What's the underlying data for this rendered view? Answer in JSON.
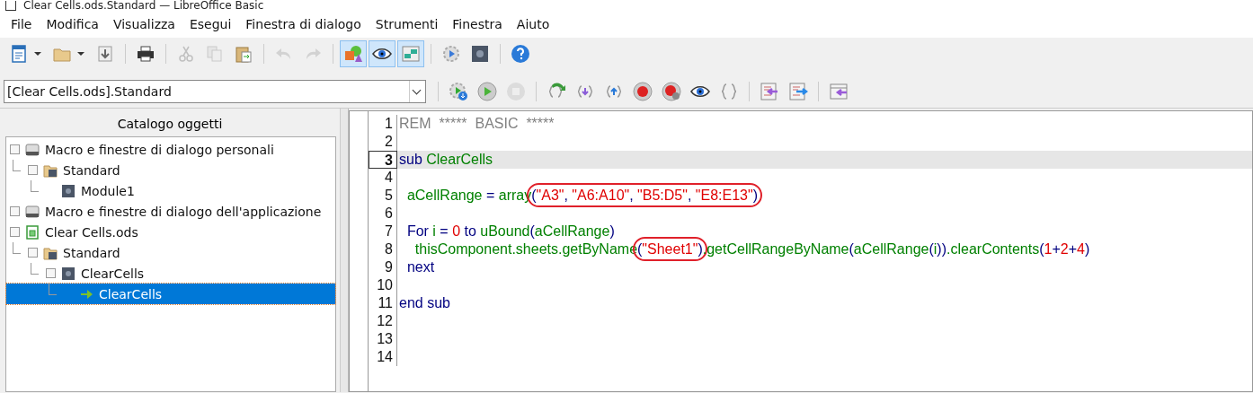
{
  "window": {
    "title": "Clear Cells.ods.Standard — LibreOffice Basic"
  },
  "menu": [
    "File",
    "Modifica",
    "Visualizza",
    "Esegui",
    "Finestra di dialogo",
    "Strumenti",
    "Finestra",
    "Aiuto"
  ],
  "toolbar": [
    {
      "kind": "new-doc",
      "dropdown": true,
      "selected": false,
      "disabled": false
    },
    {
      "kind": "folder",
      "dropdown": true,
      "selected": false,
      "disabled": false
    },
    {
      "kind": "download",
      "dropdown": false,
      "selected": false,
      "disabled": false
    },
    {
      "kind": "sep"
    },
    {
      "kind": "printer",
      "dropdown": false,
      "selected": false,
      "disabled": false
    },
    {
      "kind": "sep"
    },
    {
      "kind": "scissors",
      "dropdown": false,
      "selected": false,
      "disabled": true
    },
    {
      "kind": "copy",
      "dropdown": false,
      "selected": false,
      "disabled": true
    },
    {
      "kind": "paste",
      "dropdown": false,
      "selected": false,
      "disabled": false
    },
    {
      "kind": "sep"
    },
    {
      "kind": "undo",
      "dropdown": false,
      "selected": false,
      "disabled": true
    },
    {
      "kind": "redo",
      "dropdown": false,
      "selected": false,
      "disabled": true
    },
    {
      "kind": "sep"
    },
    {
      "kind": "shapes",
      "dropdown": false,
      "selected": true,
      "disabled": false
    },
    {
      "kind": "eye",
      "dropdown": false,
      "selected": true,
      "disabled": false
    },
    {
      "kind": "blocks",
      "dropdown": false,
      "selected": true,
      "disabled": false
    },
    {
      "kind": "sep"
    },
    {
      "kind": "gear-run",
      "dropdown": false,
      "selected": false,
      "disabled": false
    },
    {
      "kind": "gear-dark",
      "dropdown": false,
      "selected": false,
      "disabled": false
    },
    {
      "kind": "sep"
    },
    {
      "kind": "help",
      "dropdown": false,
      "selected": false,
      "disabled": false
    }
  ],
  "library_select": {
    "value": "[Clear Cells.ods].Standard"
  },
  "macro_toolbar": [
    {
      "kind": "sep"
    },
    {
      "kind": "gear-compile",
      "disabled": false
    },
    {
      "kind": "play",
      "disabled": false
    },
    {
      "kind": "stop",
      "disabled": true
    },
    {
      "kind": "sep"
    },
    {
      "kind": "step-over",
      "disabled": false
    },
    {
      "kind": "step-into",
      "disabled": false
    },
    {
      "kind": "step-out",
      "disabled": false
    },
    {
      "kind": "breakpoint",
      "disabled": false
    },
    {
      "kind": "breakpoint-gear",
      "disabled": false
    },
    {
      "kind": "eye",
      "disabled": false
    },
    {
      "kind": "braces",
      "disabled": false
    },
    {
      "kind": "sep"
    },
    {
      "kind": "import",
      "disabled": false
    },
    {
      "kind": "export",
      "disabled": false
    },
    {
      "kind": "sep"
    },
    {
      "kind": "dialog-import",
      "disabled": false
    }
  ],
  "catalog": {
    "title": "Catalogo oggetti",
    "items": [
      {
        "label": "Macro e finestre di dialogo personali",
        "kind": "drive",
        "expander": true,
        "selected": false,
        "children": [
          {
            "label": "Standard",
            "kind": "library",
            "expander": true,
            "selected": false,
            "children": [
              {
                "label": "Module1",
                "kind": "module",
                "expander": false,
                "selected": false
              }
            ]
          }
        ]
      },
      {
        "label": "Macro e finestre di dialogo dell'applicazione",
        "kind": "drive",
        "expander": true,
        "selected": false
      },
      {
        "label": "Clear Cells.ods",
        "kind": "spreadsheet",
        "expander": true,
        "selected": false,
        "children": [
          {
            "label": "Standard",
            "kind": "library",
            "expander": true,
            "selected": false,
            "children": [
              {
                "label": "ClearCells",
                "kind": "module",
                "expander": true,
                "selected": false,
                "children": [
                  {
                    "label": "ClearCells",
                    "kind": "macro",
                    "expander": false,
                    "selected": true
                  }
                ]
              }
            ]
          }
        ]
      }
    ]
  },
  "editor": {
    "lines": [
      {
        "number": "1",
        "current": false,
        "tokens": [
          {
            "kind": "rem",
            "text": "REM  *****  BASIC  *****"
          }
        ]
      },
      {
        "number": "2",
        "current": false
      },
      {
        "number": "3",
        "current": true,
        "tokens": [
          {
            "kind": "kw",
            "text": "sub "
          },
          {
            "kind": "id",
            "text": "ClearCells"
          }
        ]
      },
      {
        "number": "4",
        "current": false
      },
      {
        "number": "5",
        "current": false,
        "tokens": [
          {
            "kind": "id",
            "text": "  aCellRange "
          },
          {
            "kind": "op",
            "text": "= "
          },
          {
            "kind": "id",
            "text": "array"
          },
          {
            "kind": "circle",
            "children": [
              {
                "kind": "op",
                "text": "("
              },
              {
                "kind": "str",
                "text": "\"A3\""
              },
              {
                "kind": "op",
                "text": ", "
              },
              {
                "kind": "str",
                "text": "\"A6:A10\""
              },
              {
                "kind": "op",
                "text": ", "
              },
              {
                "kind": "str",
                "text": "\"B5:D5\""
              },
              {
                "kind": "op",
                "text": ", "
              },
              {
                "kind": "str",
                "text": "\"E8:E13\""
              },
              {
                "kind": "op",
                "text": ")"
              }
            ]
          }
        ]
      },
      {
        "number": "6",
        "current": false
      },
      {
        "number": "7",
        "current": false,
        "tokens": [
          {
            "kind": "kw",
            "text": "  For "
          },
          {
            "kind": "id",
            "text": "i "
          },
          {
            "kind": "op",
            "text": "= "
          },
          {
            "kind": "num",
            "text": "0"
          },
          {
            "kind": "kw",
            "text": " to "
          },
          {
            "kind": "id",
            "text": "uBound"
          },
          {
            "kind": "op",
            "text": "("
          },
          {
            "kind": "id",
            "text": "aCellRange"
          },
          {
            "kind": "op",
            "text": ")"
          }
        ]
      },
      {
        "number": "8",
        "current": false,
        "tokens": [
          {
            "kind": "id",
            "text": "    thisComponent.sheets.getByName"
          },
          {
            "kind": "circle",
            "children": [
              {
                "kind": "op",
                "text": "("
              },
              {
                "kind": "str",
                "text": "\"Sheet1\""
              },
              {
                "kind": "op",
                "text": ")"
              }
            ]
          },
          {
            "kind": "id",
            "text": ".getCellRangeByName"
          },
          {
            "kind": "op",
            "text": "("
          },
          {
            "kind": "id",
            "text": "aCellRange"
          },
          {
            "kind": "op",
            "text": "("
          },
          {
            "kind": "id",
            "text": "i"
          },
          {
            "kind": "op",
            "text": "))"
          },
          {
            "kind": "id",
            "text": ".clearContents"
          },
          {
            "kind": "op",
            "text": "("
          },
          {
            "kind": "num",
            "text": "1"
          },
          {
            "kind": "op",
            "text": "+"
          },
          {
            "kind": "num",
            "text": "2"
          },
          {
            "kind": "op",
            "text": "+"
          },
          {
            "kind": "num",
            "text": "4"
          },
          {
            "kind": "op",
            "text": ")"
          }
        ]
      },
      {
        "number": "9",
        "current": false,
        "tokens": [
          {
            "kind": "kw",
            "text": "  next"
          }
        ]
      },
      {
        "number": "10",
        "current": false
      },
      {
        "number": "11",
        "current": false,
        "tokens": [
          {
            "kind": "kw",
            "text": "end sub"
          }
        ]
      },
      {
        "number": "12",
        "current": false
      },
      {
        "number": "13",
        "current": false
      },
      {
        "number": "14",
        "current": false
      }
    ]
  }
}
